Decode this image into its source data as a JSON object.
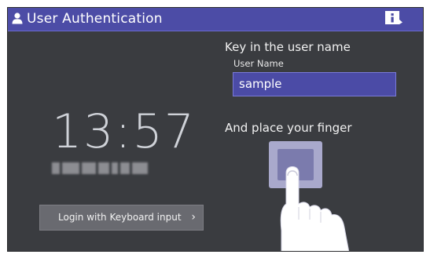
{
  "header": {
    "title": "User Authentication",
    "user_icon": "user-icon",
    "info_icon": "info-icon",
    "bar_color": "#4c4ca6"
  },
  "clock": {
    "time": "13:57"
  },
  "login_keyboard": {
    "label": "Login with Keyboard input",
    "chevron": "›"
  },
  "form": {
    "prompt": "Key in the user name",
    "field_label": "User Name",
    "username_value": "sample"
  },
  "finger": {
    "prompt": "And place your finger",
    "icon": "fingerprint-sensor-icon"
  },
  "colors": {
    "background": "#3a3c40",
    "accent": "#4c4ca6",
    "button": "#696a70"
  }
}
